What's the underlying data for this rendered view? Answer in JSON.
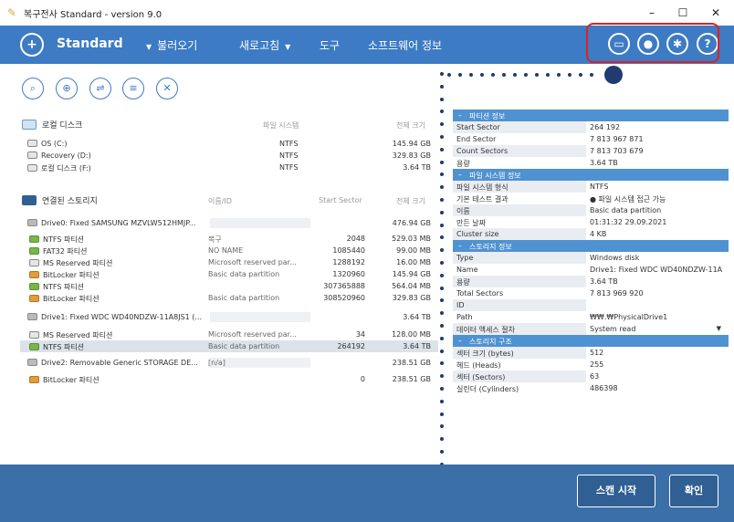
{
  "window": {
    "title": "복구전사 Standard - version 9.0",
    "minimize": "–",
    "maximize": "☐",
    "close": "✕"
  },
  "toolbar": {
    "brand": "Standard",
    "menu": [
      {
        "label": "불러오기",
        "caret": "▼"
      },
      {
        "label": "새로고침",
        "caret": "▼"
      },
      {
        "label": "도구",
        "caret": ""
      },
      {
        "label": "소프트웨어 정보",
        "caret": ""
      }
    ],
    "icons": [
      "card-icon",
      "user-icon",
      "gear-icon",
      "help-icon"
    ],
    "help_glyph": "?"
  },
  "actions": [
    {
      "name": "search-action-button",
      "glyph": "⌕"
    },
    {
      "name": "recover-action-button",
      "glyph": "⊕"
    },
    {
      "name": "mount-action-button",
      "glyph": "⇌"
    },
    {
      "name": "list-action-button",
      "glyph": "≡"
    },
    {
      "name": "close-action-button",
      "glyph": "✕"
    }
  ],
  "local": {
    "heading": "로컬 디스크",
    "col_fs": "파일 시스템",
    "col_size": "전체 크기",
    "rows": [
      {
        "name": "OS (C:)",
        "fs": "NTFS",
        "size": "145.94 GB"
      },
      {
        "name": "Recovery (D:)",
        "fs": "NTFS",
        "size": "329.83 GB"
      },
      {
        "name": "로컬 디스크 (F:)",
        "fs": "NTFS",
        "size": "3.64 TB"
      }
    ]
  },
  "storage": {
    "heading": "연결된 스토리지",
    "col_name": "이름/ID",
    "col_start": "Start Sector",
    "col_size": "전체 크기",
    "rows": [
      {
        "name": "Drive0: Fixed SAMSUNG MZVLW512HMJP...",
        "id": "",
        "start": "",
        "size": "476.94 GB",
        "icon": "grey",
        "indent": false
      },
      {
        "name": "NTFS 파티션",
        "id": "복구",
        "start": "2048",
        "size": "529.03 MB",
        "icon": "green",
        "indent": true
      },
      {
        "name": "FAT32 파티션",
        "id": "NO NAME",
        "start": "1085440",
        "size": "99.00 MB",
        "icon": "green",
        "indent": true
      },
      {
        "name": "MS Reserved 파티션",
        "id": "Microsoft reserved par...",
        "start": "1288192",
        "size": "16.00 MB",
        "icon": "plain",
        "indent": true
      },
      {
        "name": "BitLocker 파티션",
        "id": "Basic data partition",
        "start": "1320960",
        "size": "145.94 GB",
        "icon": "orange",
        "indent": true
      },
      {
        "name": "NTFS 파티션",
        "id": "",
        "start": "307365888",
        "size": "564.04 MB",
        "icon": "green",
        "indent": true
      },
      {
        "name": "BitLocker 파티션",
        "id": "Basic data partition",
        "start": "308520960",
        "size": "329.83 GB",
        "icon": "orange",
        "indent": true
      },
      {
        "name": "Drive1: Fixed WDC WD40NDZW-11A8JS1 (...",
        "id": "",
        "start": "",
        "size": "3.64 TB",
        "icon": "grey",
        "indent": false
      },
      {
        "name": "MS Reserved 파티션",
        "id": "Microsoft reserved par...",
        "start": "34",
        "size": "128.00 MB",
        "icon": "plain",
        "indent": true
      },
      {
        "name": "NTFS 파티션",
        "id": "Basic data partition",
        "start": "264192",
        "size": "3.64 TB",
        "icon": "green",
        "indent": true,
        "selected": true
      },
      {
        "name": "Drive2: Removable Generic STORAGE DE...",
        "id": "[n/a]",
        "start": "",
        "size": "238.51 GB",
        "icon": "grey",
        "indent": false
      },
      {
        "name": "BitLocker 파티션",
        "id": "",
        "start": "0",
        "size": "238.51 GB",
        "icon": "orange",
        "indent": true
      }
    ]
  },
  "details": {
    "partition_head": "파티션 정보",
    "partition": [
      {
        "k": "Start Sector",
        "v": "264 192"
      },
      {
        "k": "End Sector",
        "v": "7 813 967 871"
      },
      {
        "k": "Count Sectors",
        "v": "7 813 703 679"
      },
      {
        "k": "용량",
        "v": "3.64 TB"
      }
    ],
    "fs_head": "파일 시스템 정보",
    "fs": [
      {
        "k": "파일 시스템 형식",
        "v": "NTFS"
      },
      {
        "k": "기본 테스트 결과",
        "v": "● 파일 시스템 접근 가능"
      },
      {
        "k": "이름",
        "v": "Basic data partition"
      },
      {
        "k": "만든 날짜",
        "v": "01:31:32 29.09.2021"
      },
      {
        "k": "Cluster size",
        "v": "4 KB"
      }
    ],
    "storage_head": "스토리지 정보",
    "storage": [
      {
        "k": "Type",
        "v": "Windows disk"
      },
      {
        "k": "Name",
        "v": "Drive1: Fixed WDC WD40NDZW-11A"
      },
      {
        "k": "용량",
        "v": "3.64 TB"
      },
      {
        "k": "Total Sectors",
        "v": "7 813 969 920"
      },
      {
        "k": "ID",
        "v": ""
      },
      {
        "k": "Path",
        "v": "₩₩.₩PhysicalDrive1"
      },
      {
        "k": "데이터 액세스 절차",
        "v": "System read"
      }
    ],
    "struct_head": "스토리지 구조",
    "struct": [
      {
        "k": "섹터 크기 (bytes)",
        "v": "512"
      },
      {
        "k": "헤드 (Heads)",
        "v": "255"
      },
      {
        "k": "섹터 (Sectors)",
        "v": "63"
      },
      {
        "k": "실린더 (Cylinders)",
        "v": "486398"
      }
    ],
    "dropdown_caret": "▼",
    "status_color": "#3aa85a"
  },
  "footer": {
    "scan_label": "스캔 시작",
    "ok_label": "확인"
  },
  "colors": {
    "toolbar": "#3d7bc4",
    "footer": "#3a6fa8",
    "highlight": "#e02020",
    "section_head": "#4f92d1"
  }
}
